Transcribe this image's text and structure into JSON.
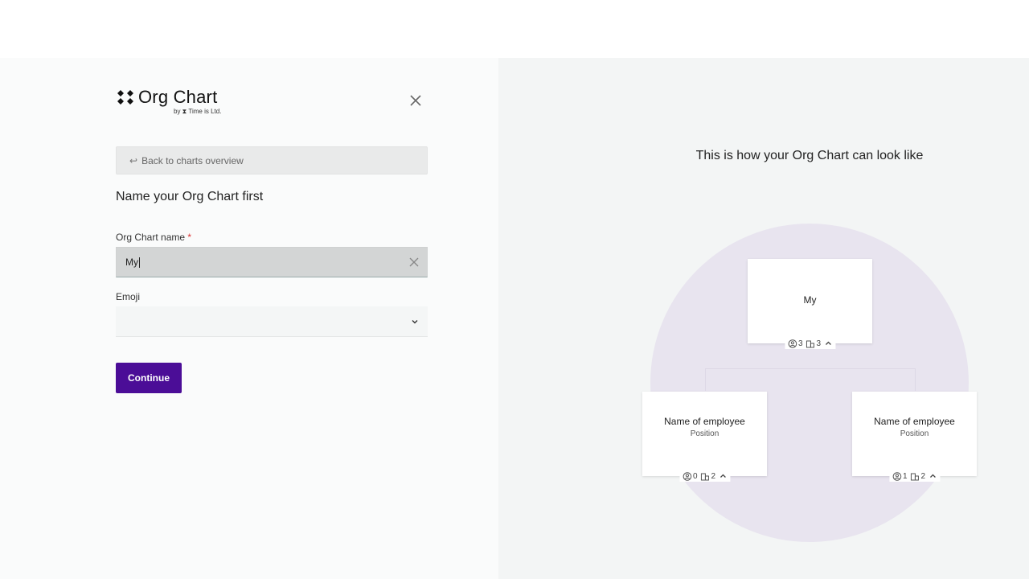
{
  "brand": {
    "title": "Org Chart",
    "subtitle": "by ⧗ Time is Ltd."
  },
  "back_button": {
    "label": "Back to charts overview"
  },
  "form": {
    "heading": "Name your Org Chart first",
    "name_label": "Org Chart name",
    "required_mark": "*",
    "name_value": "My",
    "emoji_label": "Emoji",
    "emoji_value": "",
    "continue_label": "Continue"
  },
  "preview": {
    "title": "This is how your Org Chart can look like",
    "root": {
      "name": "My",
      "people": "3",
      "teams": "3"
    },
    "children": [
      {
        "name": "Name of employee",
        "position": "Position",
        "people": "0",
        "teams": "2"
      },
      {
        "name": "Name of employee",
        "position": "Position",
        "people": "1",
        "teams": "2"
      }
    ]
  },
  "colors": {
    "primary": "#4b0d97",
    "preview_circle": "#e8e4ef",
    "required": "#dd3333"
  },
  "icons": [
    "diamond-logo-icon",
    "close-icon",
    "return-arrow-icon",
    "clear-icon",
    "chevron-down-icon",
    "person-icon",
    "building-icon",
    "chevron-up-icon"
  ]
}
